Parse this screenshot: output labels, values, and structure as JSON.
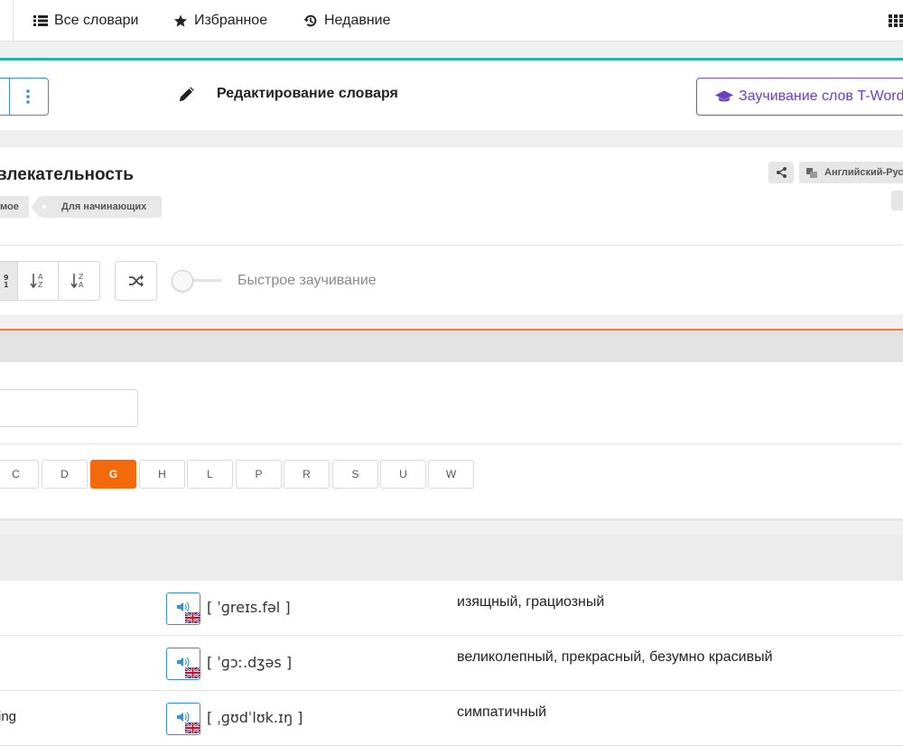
{
  "topnav": {
    "items": [
      {
        "label": "Все словари",
        "icon": "list-icon"
      },
      {
        "label": "Избранное",
        "icon": "star-icon"
      },
      {
        "label": "Недавние",
        "icon": "history-icon"
      }
    ],
    "apps_icon": "grid-icon"
  },
  "editbar": {
    "title": "Редактирование словаря",
    "learn_button": "Заучивание слов T-Word",
    "accent_color": "#26b5a8"
  },
  "dictionary": {
    "title": "влекательность",
    "tags": [
      "мое",
      "Для начинающих"
    ],
    "language": "Английский-Рус"
  },
  "tools": {
    "quick_learn_label": "Быстрое заучивание",
    "quick_learn_enabled": false
  },
  "letters": {
    "items": [
      "C",
      "D",
      "G",
      "H",
      "L",
      "P",
      "R",
      "S",
      "U",
      "W"
    ],
    "active": "G",
    "active_color": "#f26a0a"
  },
  "words": [
    {
      "word": "",
      "transcription": "[ ˈɡreɪs.fəl ]",
      "translation": "изящный, грациозный"
    },
    {
      "word": "",
      "transcription": "[ ˈɡɔː.dʒəs ]",
      "translation": "великолепный, прекрасный, безумно красивый"
    },
    {
      "word": "ing",
      "transcription": "[ ˌɡʊdˈlʊk.ɪŋ ]",
      "translation": "симпатичный"
    }
  ]
}
